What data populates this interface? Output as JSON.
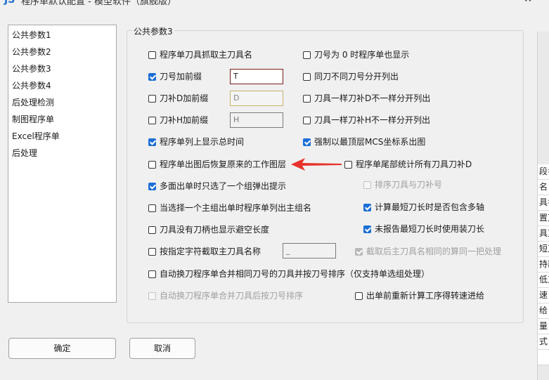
{
  "window": {
    "logo": "JS",
    "title": "程序单默认配置 - 模型软件（旗舰版）",
    "close_symbol": "✕"
  },
  "sidebar": {
    "items": [
      {
        "label": "公共参数1"
      },
      {
        "label": "公共参数2"
      },
      {
        "label": "公共参数3"
      },
      {
        "label": "公共参数4"
      },
      {
        "label": "后处理检测"
      },
      {
        "label": "制图程序单"
      },
      {
        "label": "Excel程序单"
      },
      {
        "label": "后处理"
      }
    ]
  },
  "group": {
    "title": "公共参数3",
    "options": {
      "main_tool_name": {
        "label": "程序单刀具抓取主刀具名",
        "checked": false
      },
      "tool_zero_show": {
        "label": "刀号为 0 时程序单也显示",
        "checked": false
      },
      "tool_prefix": {
        "label": "刀号加前缀",
        "checked": true
      },
      "same_tool_split": {
        "label": "同刀不同刀号分开列出",
        "checked": false
      },
      "d_comp_prefix": {
        "label": "刀补D加前缀",
        "checked": false
      },
      "same_tool_d_split": {
        "label": "刀具一样刀补D不一样分开列出",
        "checked": false
      },
      "h_comp_prefix": {
        "label": "刀补H加前缀",
        "checked": false
      },
      "same_tool_h_split": {
        "label": "刀具一样刀补H不一样分开列出",
        "checked": false
      },
      "show_total_time": {
        "label": "程序单列上显示总时间",
        "checked": true
      },
      "force_top_mcs": {
        "label": "强制以最顶层MCS坐标系出图",
        "checked": true
      },
      "restore_layer": {
        "label": "程序单出图后恢复原来的工作图层",
        "checked": false
      },
      "tail_stats": {
        "label": "程序单尾部统计所有刀具刀补D",
        "checked": false
      },
      "multi_face_popup": {
        "label": "多面出单时只选了一个组弹出提示",
        "checked": true
      },
      "sort_tool_comp": {
        "label": "排序刀具与刀补号",
        "checked": false,
        "disabled": true
      },
      "list_main_group": {
        "label": "当选择一个主组出单时程序单列出主组名",
        "checked": false
      },
      "calc_multi_axis": {
        "label": "计算最短刀长时是否包含多轴",
        "checked": true
      },
      "no_holder_avoid": {
        "label": "刀具没有刀柄也显示避空长度",
        "checked": false
      },
      "report_tool_length": {
        "label": "未报告最短刀长时使用装刀长",
        "checked": true
      },
      "cut_by_char": {
        "label": "按指定字符截取主刀具名称",
        "checked": false
      },
      "same_name_process": {
        "label": "截取后主刀具名相同的算同一把处理",
        "checked": true,
        "disabled": true
      },
      "auto_swap_sort": {
        "label": "自动换刀程序单合并相同刀号的刀具并按刀号排序（仅支持单选组处理）",
        "checked": false
      },
      "auto_swap_merge": {
        "label": "自动换刀程序单合并刀具后按刀号排序",
        "checked": false,
        "disabled": true
      },
      "recalc_feed": {
        "label": "出单前重新计算工序得转速进给",
        "checked": false
      }
    },
    "fields": {
      "tool_prefix_value": "T",
      "d_prefix_value": "D",
      "h_prefix_value": "H",
      "cut_char_value": "_"
    }
  },
  "annotation": {
    "arrow_color": "#e8322b"
  },
  "buttons": {
    "ok": "确定",
    "cancel": "取消"
  },
  "background_pane": {
    "rows": [
      "",
      "",
      "",
      "",
      "",
      "",
      "",
      "",
      "",
      "段名",
      "名",
      "具名",
      "置刀",
      "具刀",
      "短刀",
      "持器",
      "低刀",
      "速",
      "给",
      "量",
      "式",
      ""
    ]
  }
}
